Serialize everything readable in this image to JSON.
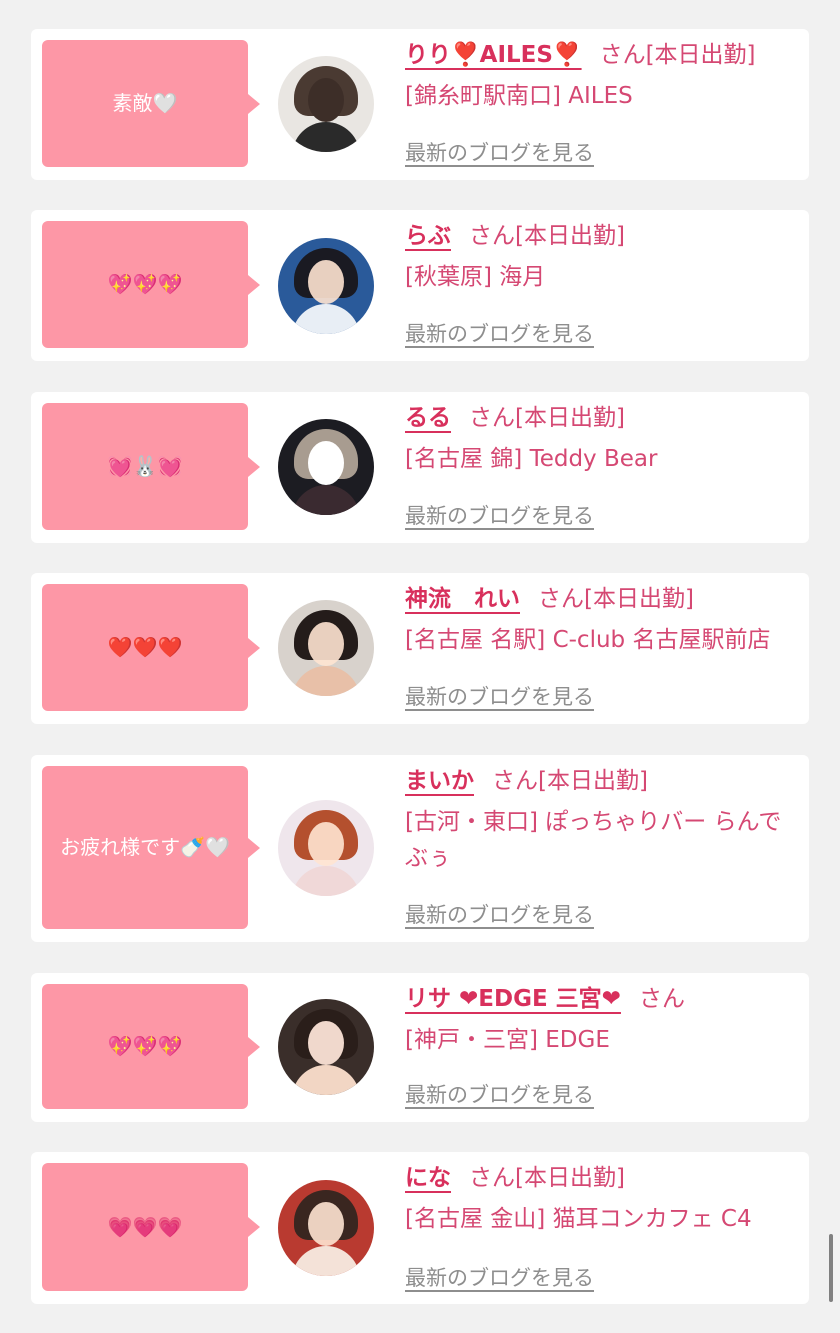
{
  "cards": [
    {
      "message": "素敵🤍",
      "name": "りり❣️AILES❣️",
      "san": "さん",
      "status": "[本日出勤]",
      "shop": "[錦糸町駅南口] AILES",
      "blog": "最新のブログを見る"
    },
    {
      "message": "💖💖💖",
      "name": "らぶ",
      "san": "さん",
      "status": "[本日出勤]",
      "shop": "[秋葉原] 海月",
      "blog": "最新のブログを見る"
    },
    {
      "message": "💓🐰💓",
      "name": "るる",
      "san": "さん",
      "status": "[本日出勤]",
      "shop": "[名古屋 錦] Teddy Bear",
      "blog": "最新のブログを見る"
    },
    {
      "message": "❤️❤️❤️",
      "name": "神流　れい",
      "san": "さん",
      "status": "[本日出勤]",
      "shop": "[名古屋 名駅] C-club 名古屋駅前店",
      "blog": "最新のブログを見る"
    },
    {
      "message": "お疲れ様です🍼🤍",
      "name": "まいか",
      "san": "さん",
      "status": "[本日出勤]",
      "shop": "[古河・東口] ぽっちゃりバー らんでぶぅ",
      "blog": "最新のブログを見る"
    },
    {
      "message": "💖💖💖",
      "name": "リサ ❤EDGE 三宮❤",
      "san": "さん",
      "status": "",
      "shop": "[神戸・三宮] EDGE",
      "blog": "最新のブログを見る"
    },
    {
      "message": "💗💗💗",
      "name": "にな",
      "san": "さん",
      "status": "[本日出勤]",
      "shop": "[名古屋 金山] 猫耳コンカフェ C4",
      "blog": "最新のブログを見る"
    }
  ],
  "colors": {
    "accent": "#d8305c",
    "bubble": "#fd97a6",
    "link_gray": "#8e8e8e"
  }
}
